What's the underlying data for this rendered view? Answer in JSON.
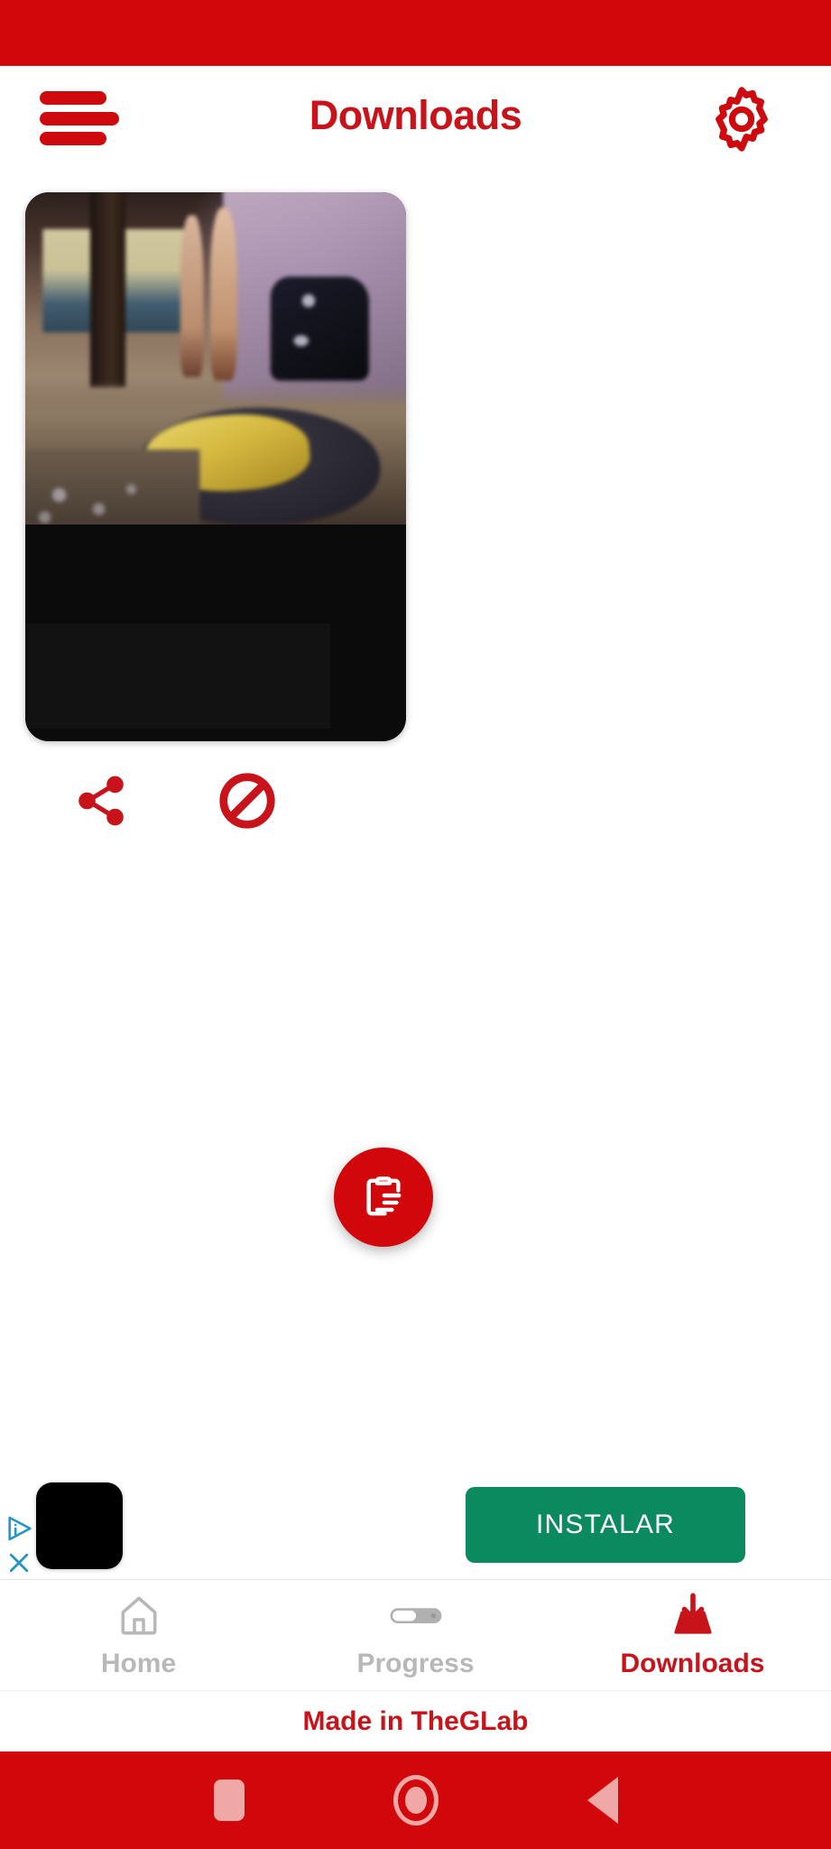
{
  "app": {
    "title": "Downloads",
    "brand_red": "#d2070b",
    "title_red": "#c8131a"
  },
  "status_bar": {
    "background": "#d2070b"
  },
  "app_bar": {
    "menu_icon": "hamburger-menu-icon",
    "title": "Downloads",
    "settings_icon": "gear-icon"
  },
  "downloads": {
    "items": [
      {
        "thumbnail": "video-thumbnail",
        "share_icon": "share-icon",
        "block_icon": "block-icon"
      }
    ]
  },
  "fab": {
    "icon": "clipboard-paste-icon",
    "color": "#d2070b"
  },
  "ad": {
    "adchoices_icon": "adchoices-icon",
    "close_icon": "close-icon",
    "app_icon": "ad-app-icon",
    "cta_label": "INSTALAR",
    "cta_color": "#0b8a5f"
  },
  "bottom_nav": {
    "items": [
      {
        "label": "Home",
        "icon": "home-icon",
        "active": false
      },
      {
        "label": "Progress",
        "icon": "toggle-slider-icon",
        "active": false
      },
      {
        "label": "Downloads",
        "icon": "download-tray-icon",
        "active": true
      }
    ],
    "inactive_color": "#b8b8b8",
    "active_color": "#c8131a"
  },
  "footer": {
    "text": "Made in TheGLab"
  },
  "android_nav": {
    "recents_icon": "square-recents-icon",
    "home_icon": "circle-home-icon",
    "back_icon": "triangle-back-icon",
    "background": "#d2070b",
    "icon_color": "#f0a8a6"
  }
}
